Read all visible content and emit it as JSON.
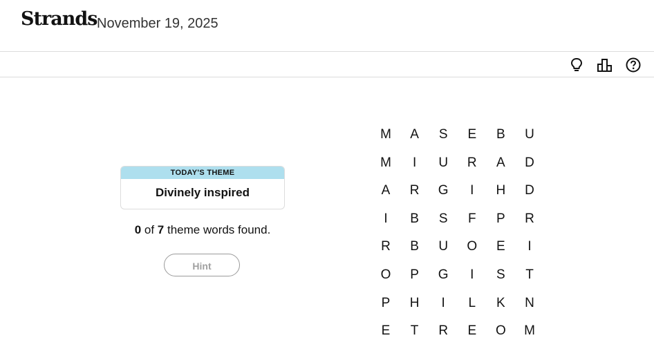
{
  "header": {
    "logo": "Strands",
    "date": "November 19, 2025"
  },
  "toolbar": {
    "icons": [
      "lightbulb-icon",
      "stats-icon",
      "help-icon"
    ]
  },
  "theme": {
    "label": "TODAY'S THEME",
    "text": "Divinely inspired"
  },
  "progress": {
    "found": "0",
    "of": " of ",
    "total": "7",
    "suffix": " theme words found."
  },
  "hint": {
    "label": "Hint",
    "enabled": false
  },
  "grid": {
    "rows": [
      [
        "M",
        "A",
        "S",
        "E",
        "B",
        "U"
      ],
      [
        "M",
        "I",
        "U",
        "R",
        "A",
        "D"
      ],
      [
        "A",
        "R",
        "G",
        "I",
        "H",
        "D"
      ],
      [
        "I",
        "B",
        "S",
        "F",
        "P",
        "R"
      ],
      [
        "R",
        "B",
        "U",
        "O",
        "E",
        "I"
      ],
      [
        "O",
        "P",
        "G",
        "I",
        "S",
        "T"
      ],
      [
        "P",
        "H",
        "I",
        "L",
        "K",
        "N"
      ],
      [
        "E",
        "T",
        "R",
        "E",
        "O",
        "M"
      ]
    ]
  },
  "colors": {
    "theme_header": "#aedfee",
    "border": "#dcdcdc",
    "text": "#121212"
  }
}
